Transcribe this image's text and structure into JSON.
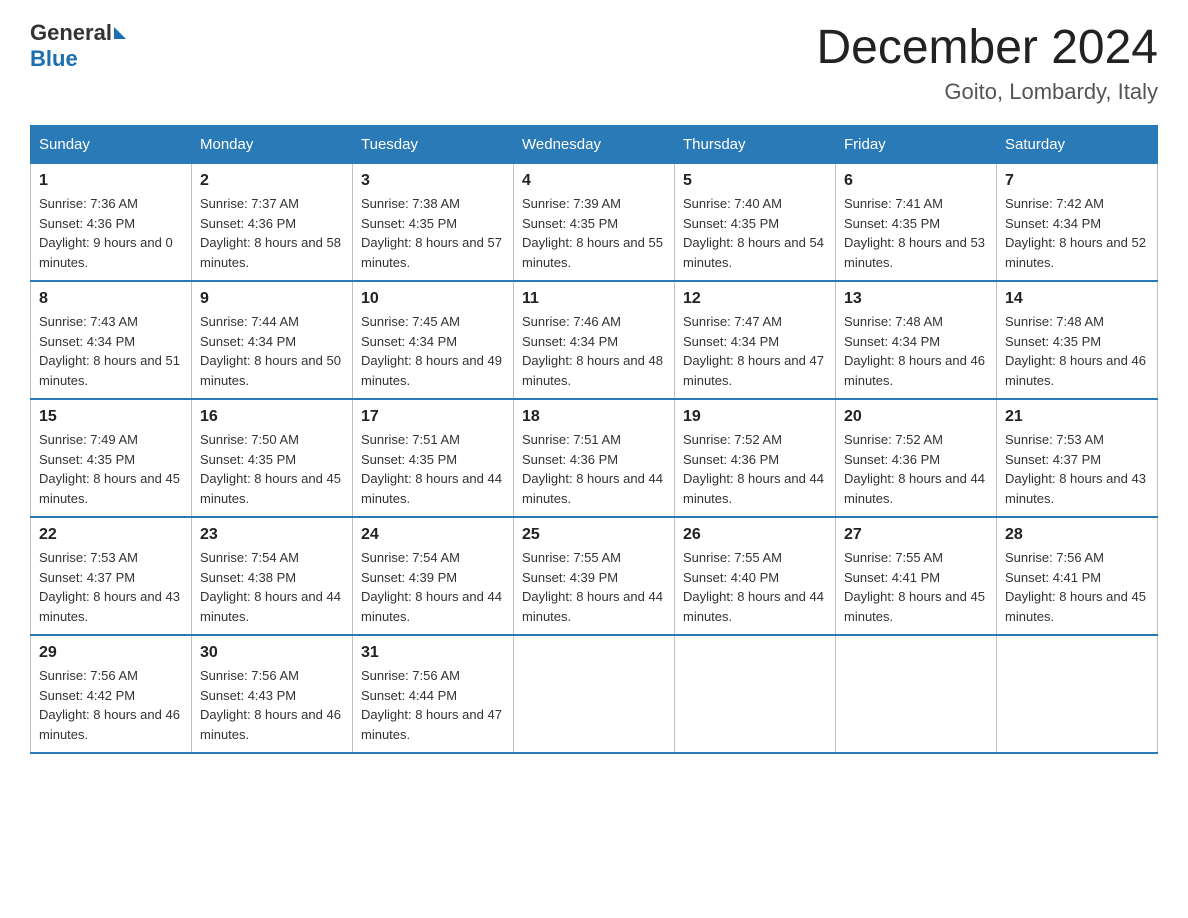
{
  "logo": {
    "general": "General",
    "blue": "Blue"
  },
  "title": "December 2024",
  "subtitle": "Goito, Lombardy, Italy",
  "days_header": [
    "Sunday",
    "Monday",
    "Tuesday",
    "Wednesday",
    "Thursday",
    "Friday",
    "Saturday"
  ],
  "weeks": [
    [
      {
        "day": "1",
        "sunrise": "7:36 AM",
        "sunset": "4:36 PM",
        "daylight": "9 hours and 0 minutes."
      },
      {
        "day": "2",
        "sunrise": "7:37 AM",
        "sunset": "4:36 PM",
        "daylight": "8 hours and 58 minutes."
      },
      {
        "day": "3",
        "sunrise": "7:38 AM",
        "sunset": "4:35 PM",
        "daylight": "8 hours and 57 minutes."
      },
      {
        "day": "4",
        "sunrise": "7:39 AM",
        "sunset": "4:35 PM",
        "daylight": "8 hours and 55 minutes."
      },
      {
        "day": "5",
        "sunrise": "7:40 AM",
        "sunset": "4:35 PM",
        "daylight": "8 hours and 54 minutes."
      },
      {
        "day": "6",
        "sunrise": "7:41 AM",
        "sunset": "4:35 PM",
        "daylight": "8 hours and 53 minutes."
      },
      {
        "day": "7",
        "sunrise": "7:42 AM",
        "sunset": "4:34 PM",
        "daylight": "8 hours and 52 minutes."
      }
    ],
    [
      {
        "day": "8",
        "sunrise": "7:43 AM",
        "sunset": "4:34 PM",
        "daylight": "8 hours and 51 minutes."
      },
      {
        "day": "9",
        "sunrise": "7:44 AM",
        "sunset": "4:34 PM",
        "daylight": "8 hours and 50 minutes."
      },
      {
        "day": "10",
        "sunrise": "7:45 AM",
        "sunset": "4:34 PM",
        "daylight": "8 hours and 49 minutes."
      },
      {
        "day": "11",
        "sunrise": "7:46 AM",
        "sunset": "4:34 PM",
        "daylight": "8 hours and 48 minutes."
      },
      {
        "day": "12",
        "sunrise": "7:47 AM",
        "sunset": "4:34 PM",
        "daylight": "8 hours and 47 minutes."
      },
      {
        "day": "13",
        "sunrise": "7:48 AM",
        "sunset": "4:34 PM",
        "daylight": "8 hours and 46 minutes."
      },
      {
        "day": "14",
        "sunrise": "7:48 AM",
        "sunset": "4:35 PM",
        "daylight": "8 hours and 46 minutes."
      }
    ],
    [
      {
        "day": "15",
        "sunrise": "7:49 AM",
        "sunset": "4:35 PM",
        "daylight": "8 hours and 45 minutes."
      },
      {
        "day": "16",
        "sunrise": "7:50 AM",
        "sunset": "4:35 PM",
        "daylight": "8 hours and 45 minutes."
      },
      {
        "day": "17",
        "sunrise": "7:51 AM",
        "sunset": "4:35 PM",
        "daylight": "8 hours and 44 minutes."
      },
      {
        "day": "18",
        "sunrise": "7:51 AM",
        "sunset": "4:36 PM",
        "daylight": "8 hours and 44 minutes."
      },
      {
        "day": "19",
        "sunrise": "7:52 AM",
        "sunset": "4:36 PM",
        "daylight": "8 hours and 44 minutes."
      },
      {
        "day": "20",
        "sunrise": "7:52 AM",
        "sunset": "4:36 PM",
        "daylight": "8 hours and 44 minutes."
      },
      {
        "day": "21",
        "sunrise": "7:53 AM",
        "sunset": "4:37 PM",
        "daylight": "8 hours and 43 minutes."
      }
    ],
    [
      {
        "day": "22",
        "sunrise": "7:53 AM",
        "sunset": "4:37 PM",
        "daylight": "8 hours and 43 minutes."
      },
      {
        "day": "23",
        "sunrise": "7:54 AM",
        "sunset": "4:38 PM",
        "daylight": "8 hours and 44 minutes."
      },
      {
        "day": "24",
        "sunrise": "7:54 AM",
        "sunset": "4:39 PM",
        "daylight": "8 hours and 44 minutes."
      },
      {
        "day": "25",
        "sunrise": "7:55 AM",
        "sunset": "4:39 PM",
        "daylight": "8 hours and 44 minutes."
      },
      {
        "day": "26",
        "sunrise": "7:55 AM",
        "sunset": "4:40 PM",
        "daylight": "8 hours and 44 minutes."
      },
      {
        "day": "27",
        "sunrise": "7:55 AM",
        "sunset": "4:41 PM",
        "daylight": "8 hours and 45 minutes."
      },
      {
        "day": "28",
        "sunrise": "7:56 AM",
        "sunset": "4:41 PM",
        "daylight": "8 hours and 45 minutes."
      }
    ],
    [
      {
        "day": "29",
        "sunrise": "7:56 AM",
        "sunset": "4:42 PM",
        "daylight": "8 hours and 46 minutes."
      },
      {
        "day": "30",
        "sunrise": "7:56 AM",
        "sunset": "4:43 PM",
        "daylight": "8 hours and 46 minutes."
      },
      {
        "day": "31",
        "sunrise": "7:56 AM",
        "sunset": "4:44 PM",
        "daylight": "8 hours and 47 minutes."
      },
      null,
      null,
      null,
      null
    ]
  ]
}
